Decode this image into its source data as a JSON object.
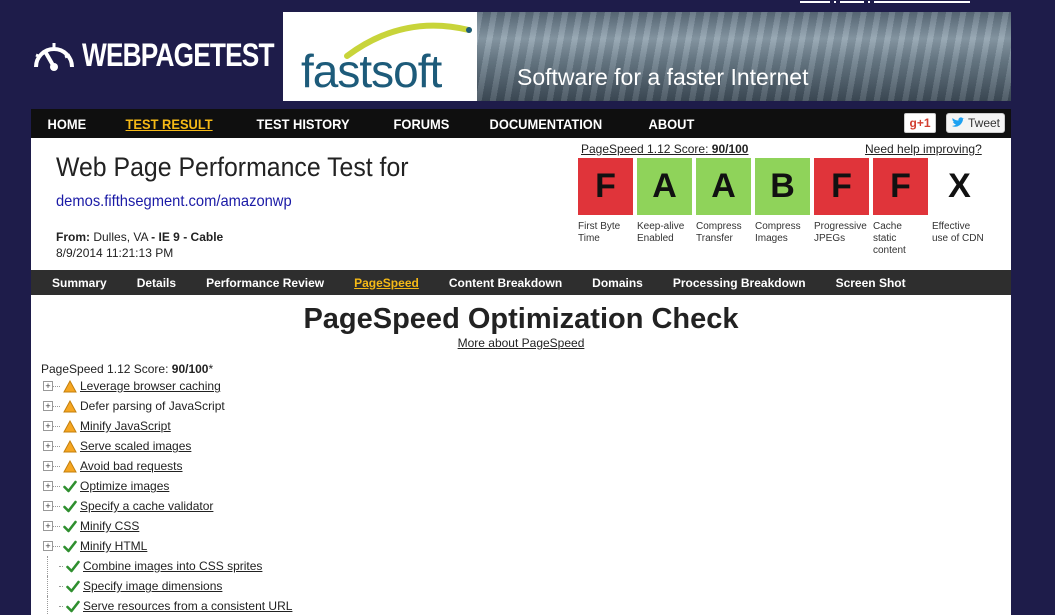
{
  "header": {
    "logo_text": "WEBPAGETEST",
    "banner": {
      "brand": "fastsoft",
      "tagline": "Software for a faster Internet"
    },
    "social": {
      "gplus_label": "g+1",
      "tweet_label": "Tweet"
    }
  },
  "main_nav": [
    {
      "label": "HOME",
      "active": false
    },
    {
      "label": "TEST RESULT",
      "active": true
    },
    {
      "label": "TEST HISTORY",
      "active": false
    },
    {
      "label": "FORUMS",
      "active": false
    },
    {
      "label": "DOCUMENTATION",
      "active": false
    },
    {
      "label": "ABOUT",
      "active": false
    }
  ],
  "test": {
    "title": "Web Page Performance Test for",
    "url": "demos.fifthsegment.com/amazonwp",
    "from_label": "From:",
    "from_value": "Dulles, VA",
    "browser": "IE 9",
    "connection": "Cable",
    "date": "8/9/2014 11:21:13 PM"
  },
  "score_summary": {
    "label": "PageSpeed 1.12 Score",
    "value": "90/100",
    "help_link": "Need help improving?"
  },
  "grades": [
    {
      "grade": "F",
      "label": "First Byte Time",
      "color": "#e0343a"
    },
    {
      "grade": "A",
      "label": "Keep-alive Enabled",
      "color": "#8fd35a"
    },
    {
      "grade": "A",
      "label": "Compress Transfer",
      "color": "#8fd35a"
    },
    {
      "grade": "B",
      "label": "Compress Images",
      "color": "#8fd35a"
    },
    {
      "grade": "F",
      "label": "Progressive JPEGs",
      "color": "#e0343a"
    },
    {
      "grade": "F",
      "label": "Cache static content",
      "color": "#e0343a"
    },
    {
      "grade": "X",
      "label": "Effective use of CDN",
      "color": "#ffffff"
    }
  ],
  "sub_nav": [
    {
      "label": "Summary",
      "active": false
    },
    {
      "label": "Details",
      "active": false
    },
    {
      "label": "Performance Review",
      "active": false
    },
    {
      "label": "PageSpeed",
      "active": true
    },
    {
      "label": "Content Breakdown",
      "active": false
    },
    {
      "label": "Domains",
      "active": false
    },
    {
      "label": "Processing Breakdown",
      "active": false
    },
    {
      "label": "Screen Shot",
      "active": false
    }
  ],
  "page": {
    "heading": "PageSpeed Optimization Check",
    "more_link": "More about PageSpeed",
    "score_prefix": "PageSpeed 1.12 Score: ",
    "score_value": "90/100",
    "score_suffix": "*"
  },
  "rules": [
    {
      "label": "Leverage browser caching",
      "status": "warning",
      "expandable": true,
      "link": true
    },
    {
      "label": "Defer parsing of JavaScript",
      "status": "warning",
      "expandable": true,
      "link": false
    },
    {
      "label": "Minify JavaScript",
      "status": "warning",
      "expandable": true,
      "link": true
    },
    {
      "label": "Serve scaled images",
      "status": "warning",
      "expandable": true,
      "link": true
    },
    {
      "label": "Avoid bad requests",
      "status": "warning",
      "expandable": true,
      "link": true
    },
    {
      "label": "Optimize images",
      "status": "pass",
      "expandable": true,
      "link": true
    },
    {
      "label": "Specify a cache validator",
      "status": "pass",
      "expandable": true,
      "link": true
    },
    {
      "label": "Minify CSS",
      "status": "pass",
      "expandable": true,
      "link": true
    },
    {
      "label": "Minify HTML",
      "status": "pass",
      "expandable": true,
      "link": true
    },
    {
      "label": "Combine images into CSS sprites",
      "status": "pass",
      "expandable": false,
      "link": true
    },
    {
      "label": "Specify image dimensions",
      "status": "pass",
      "expandable": false,
      "link": true
    },
    {
      "label": "Serve resources from a consistent URL",
      "status": "pass",
      "expandable": false,
      "link": true
    }
  ]
}
